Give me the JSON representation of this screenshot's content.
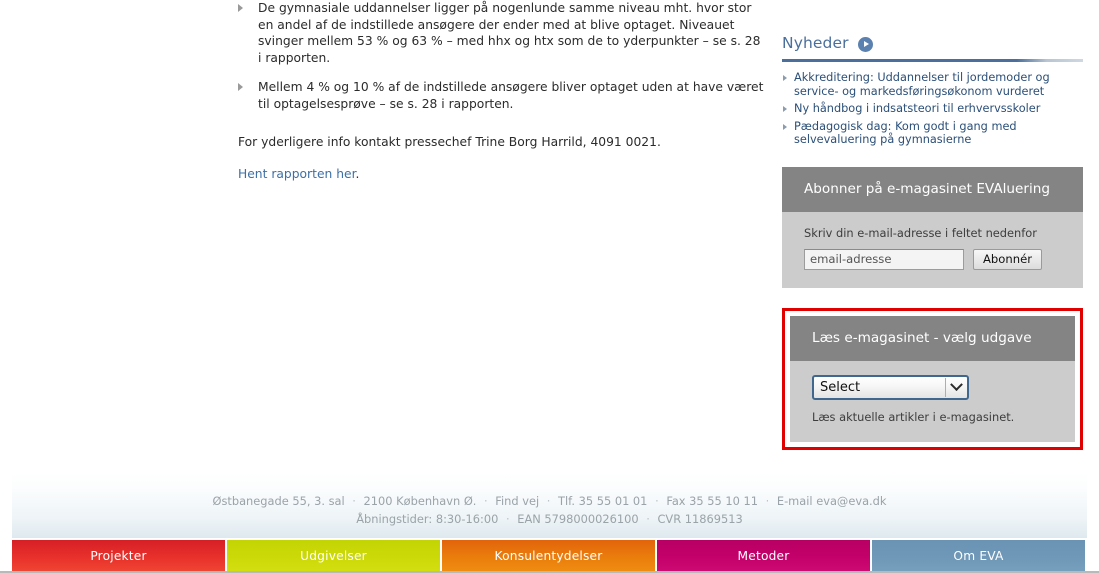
{
  "article": {
    "bullets": [
      "De gymnasiale uddannelser ligger på nogenlunde samme niveau mht. hvor stor en andel af de indstillede ansøgere der ender med at blive optaget. Niveauet svinger mellem 53 % og 63 % – med hhx og htx som de to yderpunkter – se s. 28 i rapporten.",
      "Mellem 4 % og 10 % af de indstillede ansøgere bliver optaget uden at have været til optagelsesprøve – se s. 28 i rapporten."
    ],
    "contact": "For yderligere info kontakt pressechef Trine Borg Harrild, 4091 0021.",
    "report_link": "Hent rapporten her",
    "report_link_tail": "."
  },
  "news": {
    "title": "Nyheder",
    "play_icon": "play-circle-icon",
    "items": [
      "Akkreditering: Uddannelser til jordemoder og service- og markedsføringsøkonom vurderet",
      "Ny håndbog i indsatsteori til erhvervsskoler",
      "Pædagogisk dag: Kom godt i gang med selvevaluering på gymnasierne"
    ]
  },
  "subscribe": {
    "heading": "Abonner på e-magasinet EVAluering",
    "hint": "Skriv din e-mail-adresse i feltet nedenfor",
    "input_value": "email-adresse",
    "button_label": "Abonnér"
  },
  "emagazine": {
    "heading": "Læs e-magasinet - vælg udgave",
    "select_value": "Select",
    "select_arrow_icon": "chevron-down-icon",
    "note": "Læs aktuelle artikler i e-magasinet.",
    "highlight_color": "#e00000"
  },
  "footer": {
    "line1": [
      "Østbanegade 55, 3. sal",
      "2100 København Ø.",
      "Find vej",
      "Tlf. 35 55 01 01",
      "Fax 35 55 10 11",
      "E-mail eva@eva.dk"
    ],
    "line2": [
      "Åbningstider: 8:30-16:00",
      "EAN 5798000026100",
      "CVR 11869513"
    ],
    "separator": "·"
  },
  "nav": {
    "items": [
      {
        "label": "Projekter",
        "color": "#e8302b"
      },
      {
        "label": "Udgivelser",
        "color": "#ccd908"
      },
      {
        "label": "Konsulentydelser",
        "color": "#ea7d0c"
      },
      {
        "label": "Metoder",
        "color": "#c4006a"
      },
      {
        "label": "Om EVA",
        "color": "#6f97b7"
      }
    ]
  }
}
